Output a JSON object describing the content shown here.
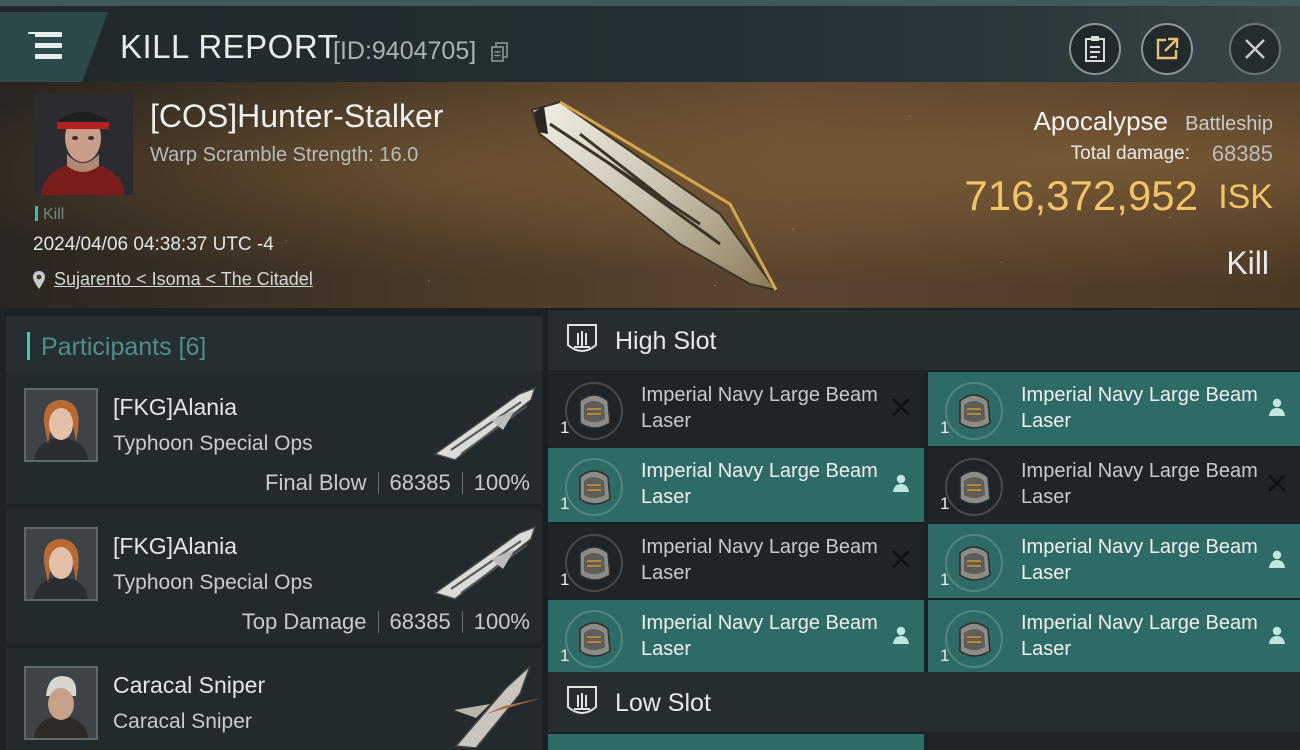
{
  "window": {
    "title": "KILL REPORT",
    "report_id": "[ID:9404705]"
  },
  "victim": {
    "pilot_name": "[COS]Hunter-Stalker",
    "warp_scramble": "Warp Scramble Strength: 16.0",
    "tag": "Kill",
    "datetime": "2024/04/06 04:38:37 UTC -4",
    "location": "Sujarento < Isoma < The Citadel",
    "ship_name": "Apocalypse",
    "ship_class": "Battleship",
    "total_damage_label": "Total damage:",
    "total_damage": "68385",
    "isk_value": "716,372,952",
    "isk_unit": "ISK",
    "result": "Kill"
  },
  "participants": {
    "heading": "Participants [6]",
    "rows": [
      {
        "name": "[FKG]Alania",
        "ship": "Typhoon Special Ops",
        "role": "Final Blow",
        "damage": "68385",
        "percent": "100%"
      },
      {
        "name": "[FKG]Alania",
        "ship": "Typhoon Special Ops",
        "role": "Top Damage",
        "damage": "68385",
        "percent": "100%"
      },
      {
        "name": "Caracal Sniper",
        "ship": "Caracal Sniper"
      }
    ]
  },
  "slots": {
    "high_title": "High Slot",
    "low_title": "Low Slot",
    "high_modules": [
      {
        "name": "Imperial Navy Large Beam Laser",
        "qty": "1",
        "status": "destroyed"
      },
      {
        "name": "Imperial Navy Large Beam Laser",
        "qty": "1",
        "status": "dropped"
      },
      {
        "name": "Imperial Navy Large Beam Laser",
        "qty": "1",
        "status": "dropped"
      },
      {
        "name": "Imperial Navy Large Beam Laser",
        "qty": "1",
        "status": "destroyed"
      },
      {
        "name": "Imperial Navy Large Beam Laser",
        "qty": "1",
        "status": "destroyed"
      },
      {
        "name": "Imperial Navy Large Beam Laser",
        "qty": "1",
        "status": "dropped"
      },
      {
        "name": "Imperial Navy Large Beam Laser",
        "qty": "1",
        "status": "dropped"
      },
      {
        "name": "Imperial Navy Large Beam Laser",
        "qty": "1",
        "status": "dropped"
      }
    ]
  },
  "colors": {
    "accent_teal": "#2e6b66",
    "isk_gold": "#f1c46a"
  },
  "icons": [
    "menu-icon",
    "copy-icon",
    "clipboard-icon",
    "share-icon",
    "close-icon",
    "location-pin-icon",
    "slot-icon",
    "destroyed-x-icon",
    "dropped-pilot-icon"
  ]
}
